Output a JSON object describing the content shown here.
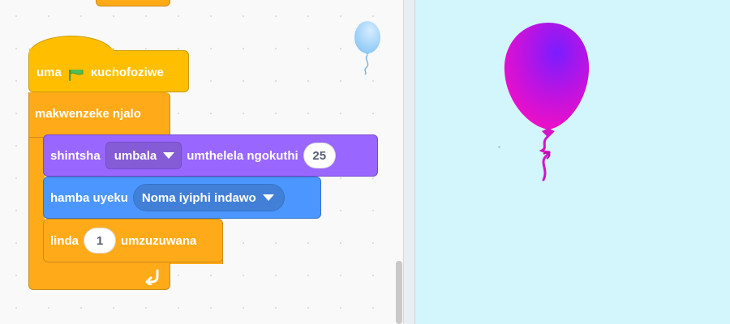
{
  "code_area": {
    "blocks": {
      "event_hat": {
        "label_before": "uma",
        "label_after": "kuchofoziwe",
        "icon": "green-flag-icon"
      },
      "forever": {
        "label": "makwenzeke njalo",
        "icon": "loop-arrow-icon"
      },
      "looks_change_effect": {
        "label_before": "shintsha",
        "effect_value": "umbala",
        "label_after": "umthelela ngokuthi",
        "amount": "25"
      },
      "motion_goto": {
        "label": "hamba uyeku",
        "target_value": "Noma iyiphi indawo"
      },
      "control_wait": {
        "label_before": "linda",
        "seconds": "1",
        "label_after": "umzuzuwana"
      }
    },
    "sprite_thumbnail": "balloon-sprite-thumbnail"
  },
  "stage": {
    "background_color": "#d3f5fc",
    "sprite": "balloon-sprite"
  },
  "colors": {
    "events": "#ffbf00",
    "control": "#ffab19",
    "looks": "#9966ff",
    "motion": "#4c97ff"
  }
}
